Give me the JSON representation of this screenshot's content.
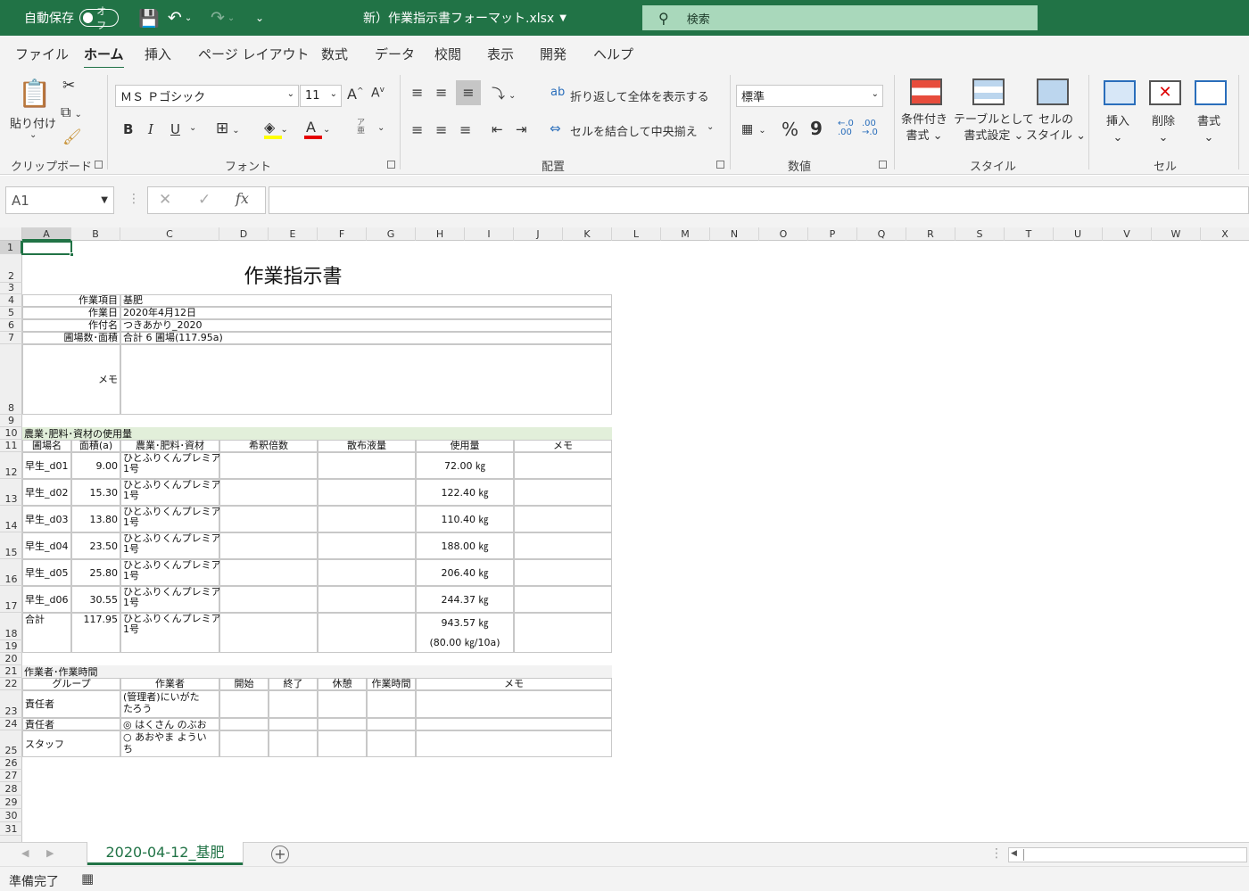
{
  "titlebar": {
    "autosave_label": "自動保存",
    "autosave_state": "オフ",
    "file_title": "新）作業指示書フォーマット.xlsx",
    "search_placeholder": "検索"
  },
  "tabs": [
    "ファイル",
    "ホーム",
    "挿入",
    "ページ レイアウト",
    "数式",
    "データ",
    "校閲",
    "表示",
    "開発",
    "ヘルプ"
  ],
  "ribbon": {
    "clipboard": {
      "paste": "貼り付け",
      "label": "クリップボード"
    },
    "font": {
      "name": "ＭＳ Ｐゴシック",
      "size": "11",
      "label": "フォント",
      "bold": "B",
      "italic": "I",
      "underline": "U"
    },
    "align": {
      "wrap": "折り返して全体を表示する",
      "merge": "セルを結合して中央揃え",
      "label": "配置"
    },
    "number": {
      "format": "標準",
      "percent": "%",
      "comma": "9",
      "label": "数値"
    },
    "styles": {
      "cond1": "条件付き",
      "cond2": "書式",
      "table1": "テーブルとして",
      "table2": "書式設定",
      "cell1": "セルの",
      "cell2": "スタイル",
      "label": "スタイル"
    },
    "cells": {
      "insert": "挿入",
      "delete": "削除",
      "format": "書式",
      "label": "セル"
    }
  },
  "formula": {
    "namebox": "A1",
    "fx": "fx",
    "value": ""
  },
  "columns": [
    "A",
    "B",
    "C",
    "D",
    "E",
    "F",
    "G",
    "H",
    "I",
    "J",
    "K",
    "L",
    "M",
    "N",
    "O",
    "P",
    "Q",
    "R",
    "S",
    "T",
    "U",
    "V",
    "W",
    "X"
  ],
  "rows": [
    "1",
    "2",
    "3",
    "4",
    "5",
    "6",
    "7",
    "8",
    "9",
    "10",
    "11",
    "12",
    "13",
    "14",
    "15",
    "16",
    "17",
    "18",
    "19",
    "20",
    "21",
    "22",
    "23",
    "24",
    "25",
    "26",
    "27",
    "28",
    "29",
    "30",
    "31"
  ],
  "sheet": {
    "title": "作業指示書",
    "info": [
      {
        "label": "作業項目",
        "value": "基肥"
      },
      {
        "label": "作業日",
        "value": "2020年4月12日"
      },
      {
        "label": "作付名",
        "value": "つきあかり_2020"
      },
      {
        "label": "圃場数･面積",
        "value": "合計 6 圃場(117.95a)"
      },
      {
        "label": "メモ",
        "value": ""
      }
    ],
    "section1": "農業･肥料･資材の使用量",
    "table1_headers": [
      "圃場名",
      "面積(a)",
      "農業･肥料･資材",
      "希釈倍数",
      "散布液量",
      "使用量",
      "メモ"
    ],
    "table1_rows": [
      {
        "field": "早生_d01",
        "area": "9.00",
        "material": "ひとふりくんプレミア",
        "material2": "1号",
        "usage": "72.00 ㎏"
      },
      {
        "field": "早生_d02",
        "area": "15.30",
        "material": "ひとふりくんプレミア",
        "material2": "1号",
        "usage": "122.40 ㎏"
      },
      {
        "field": "早生_d03",
        "area": "13.80",
        "material": "ひとふりくんプレミア",
        "material2": "1号",
        "usage": "110.40 ㎏"
      },
      {
        "field": "早生_d04",
        "area": "23.50",
        "material": "ひとふりくんプレミア",
        "material2": "1号",
        "usage": "188.00 ㎏"
      },
      {
        "field": "早生_d05",
        "area": "25.80",
        "material": "ひとふりくんプレミア",
        "material2": "1号",
        "usage": "206.40 ㎏"
      },
      {
        "field": "早生_d06",
        "area": "30.55",
        "material": "ひとふりくんプレミア",
        "material2": "1号",
        "usage": "244.37 ㎏"
      }
    ],
    "total": {
      "label": "合計",
      "area": "117.95",
      "material": "ひとふりくんプレミア",
      "material2": "1号",
      "usage": "943.57 ㎏",
      "per10a": "(80.00 ㎏/10a)"
    },
    "section2": "作業者･作業時間",
    "table2_headers": [
      "グループ",
      "作業者",
      "開始",
      "終了",
      "休憩",
      "作業時間",
      "メモ"
    ],
    "table2_rows": [
      {
        "group": "責任者",
        "worker": "(管理者)にいがた",
        "worker2": "たろう"
      },
      {
        "group": "責任者",
        "worker": "◎ はくさん のぶお",
        "worker2": ""
      },
      {
        "group": "スタッフ",
        "worker": "○ あおやま ようい",
        "worker2": "ち"
      }
    ]
  },
  "sheet_tab": "2020-04-12_基肥",
  "status": "準備完了",
  "colors": {
    "accent": "#217346",
    "section_fill": "#e2efda"
  }
}
